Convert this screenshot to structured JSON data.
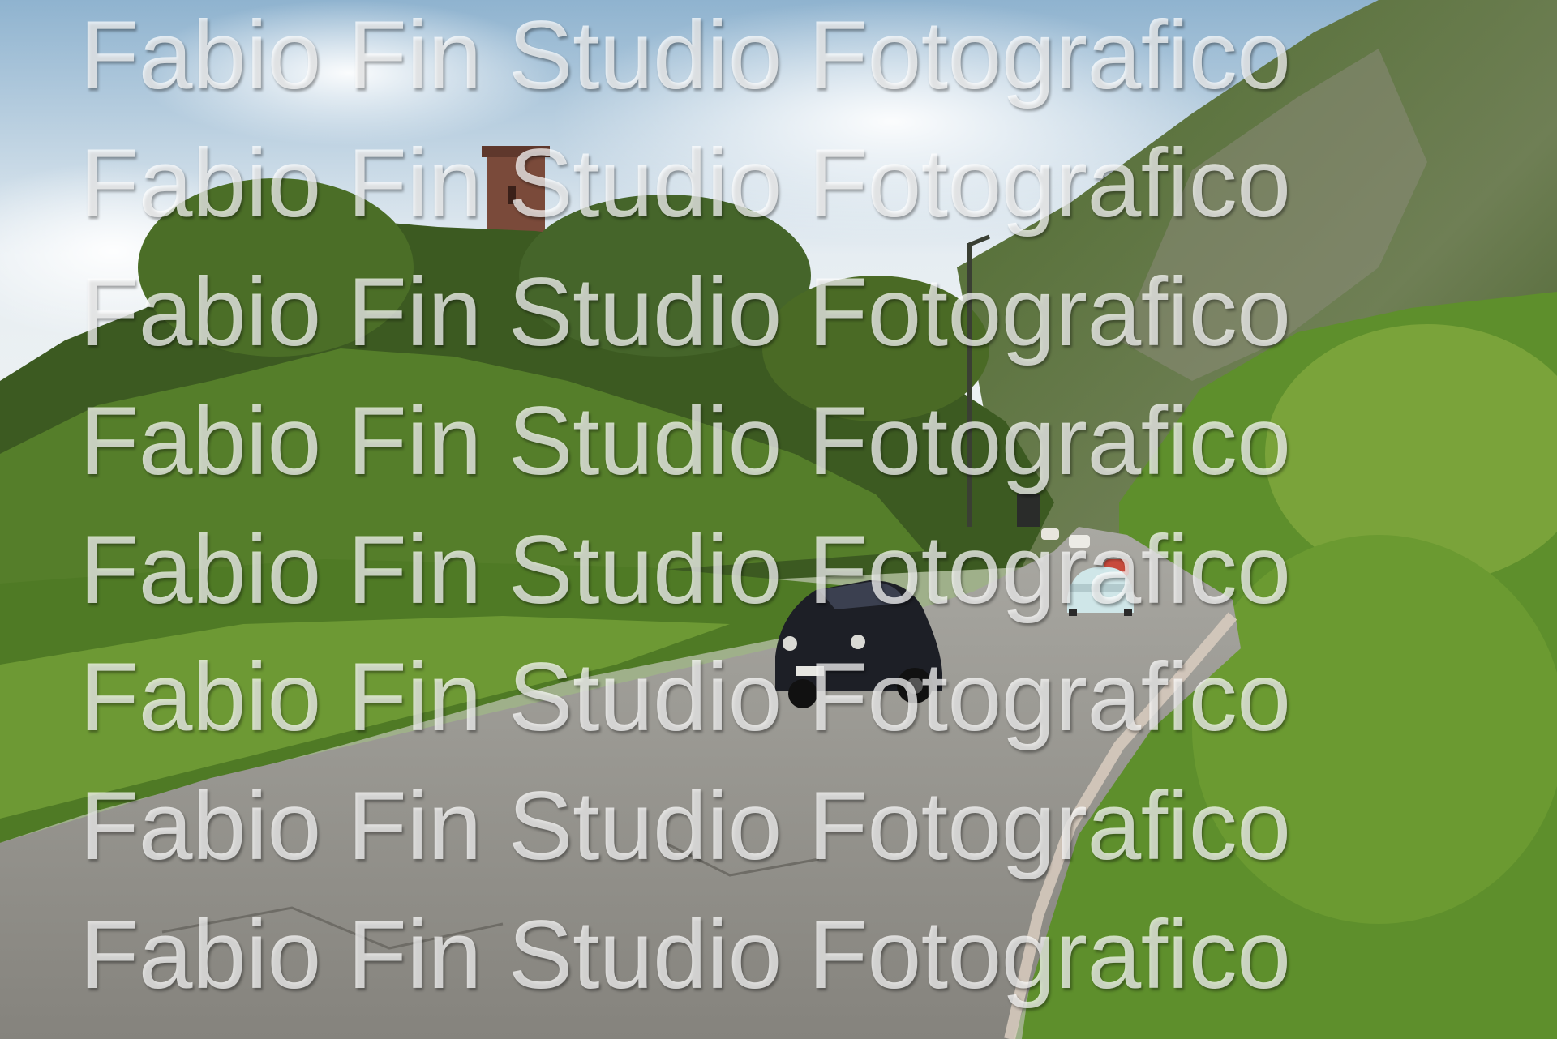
{
  "photo": {
    "scene": "country-road-with-vintage-cars",
    "colors": {
      "sky": "#dfe8ef",
      "foliage_dark": "#2f4a1c",
      "foliage_light": "#7aa33a",
      "road": "#8e8c86",
      "car_dark": "#1d1f26",
      "car_light": "#cfe6e8",
      "tower": "#7a4a3a"
    }
  },
  "watermark": {
    "lines": [
      "Fabio Fin Studio Fotografico",
      "Fabio Fin Studio Fotografico",
      "Fabio Fin Studio Fotografico",
      "Fabio Fin Studio Fotografico",
      "Fabio Fin Studio Fotografico",
      "Fabio Fin Studio Fotografico",
      "Fabio Fin Studio Fotografico",
      "Fabio Fin Studio Fotografico"
    ]
  }
}
